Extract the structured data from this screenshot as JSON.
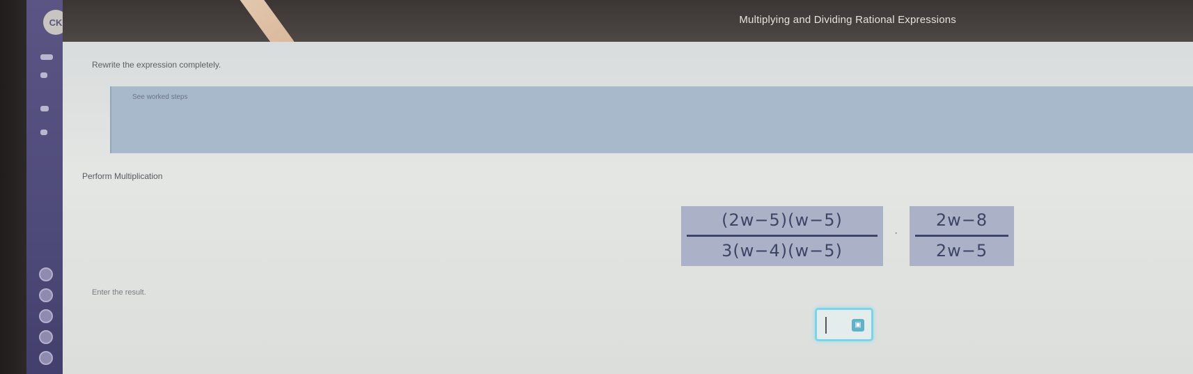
{
  "header": {
    "title": "Multiplying and Dividing Rational Expressions"
  },
  "question": {
    "prompt": "Rewrite the expression completely.",
    "banner_text": "See worked steps",
    "step_label": "Perform Multiplication",
    "expression": {
      "fraction1": {
        "numerator": "(2w−5)(w−5)",
        "denominator": "3(w−4)(w−5)"
      },
      "operator": "·",
      "fraction2": {
        "numerator": "2w−8",
        "denominator": "2w−5"
      }
    },
    "enter_label": "Enter the result.",
    "answer": {
      "value": "",
      "submit_icon": "keypad-icon"
    }
  },
  "rail": {
    "logo_text": "CK",
    "icons": [
      "menu-icon",
      "bookmark-icon",
      "flag-icon",
      "info-icon"
    ]
  },
  "colors": {
    "rail": "#5b5583",
    "banner": "#a8b9cc",
    "expression_bg": "#abb2c8",
    "answer_border": "#7bd4e8"
  }
}
